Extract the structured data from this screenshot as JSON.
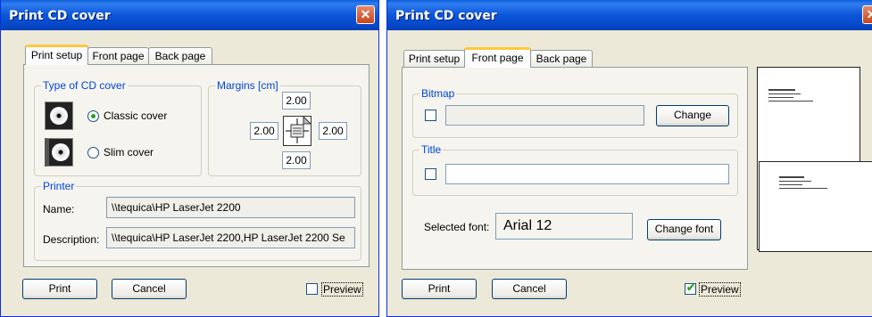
{
  "window1": {
    "title": "Print CD cover",
    "close_glyph": "✕",
    "tabs": [
      "Print setup",
      "Front page",
      "Back page"
    ],
    "active_tab": "Print setup",
    "type_group": {
      "legend": "Type of CD cover",
      "classic_label": "Classic cover",
      "slim_label": "Slim cover",
      "selected": "Classic cover",
      "icons": [
        "cd-classic-icon",
        "cd-slim-icon"
      ]
    },
    "margins": {
      "legend": "Margins [cm]",
      "top": "2.00",
      "left": "2.00",
      "right": "2.00",
      "bottom": "2.00"
    },
    "printer": {
      "legend": "Printer",
      "name_label": "Name:",
      "name_value": "\\\\tequica\\HP LaserJet 2200",
      "description_label": "Description:",
      "description_value": "\\\\tequica\\HP LaserJet 2200,HP LaserJet 2200 Se"
    },
    "print_button": "Print",
    "cancel_button": "Cancel",
    "preview_label": "Preview",
    "preview_checked": false
  },
  "window2": {
    "title": "Print CD cover",
    "tabs": [
      "Print setup",
      "Front page",
      "Back page"
    ],
    "active_tab": "Front page",
    "bitmap": {
      "legend": "Bitmap",
      "checked": false,
      "value": "",
      "change_button": "Change"
    },
    "title_group": {
      "legend": "Title",
      "checked": false,
      "value": ""
    },
    "selected_font_label": "Selected font:",
    "selected_font_value": "Arial 12",
    "change_font_button": "Change font",
    "print_button": "Print",
    "cancel_button": "Cancel",
    "preview_label": "Preview",
    "preview_checked": true,
    "check_glyph": "✔"
  },
  "colors": {
    "titlebar": "#0a5fd8",
    "window_bg": "#ece9d8",
    "legend_text": "#0046d5",
    "close_button": "#c8451e",
    "tab_highlight": "#ffc83c"
  }
}
